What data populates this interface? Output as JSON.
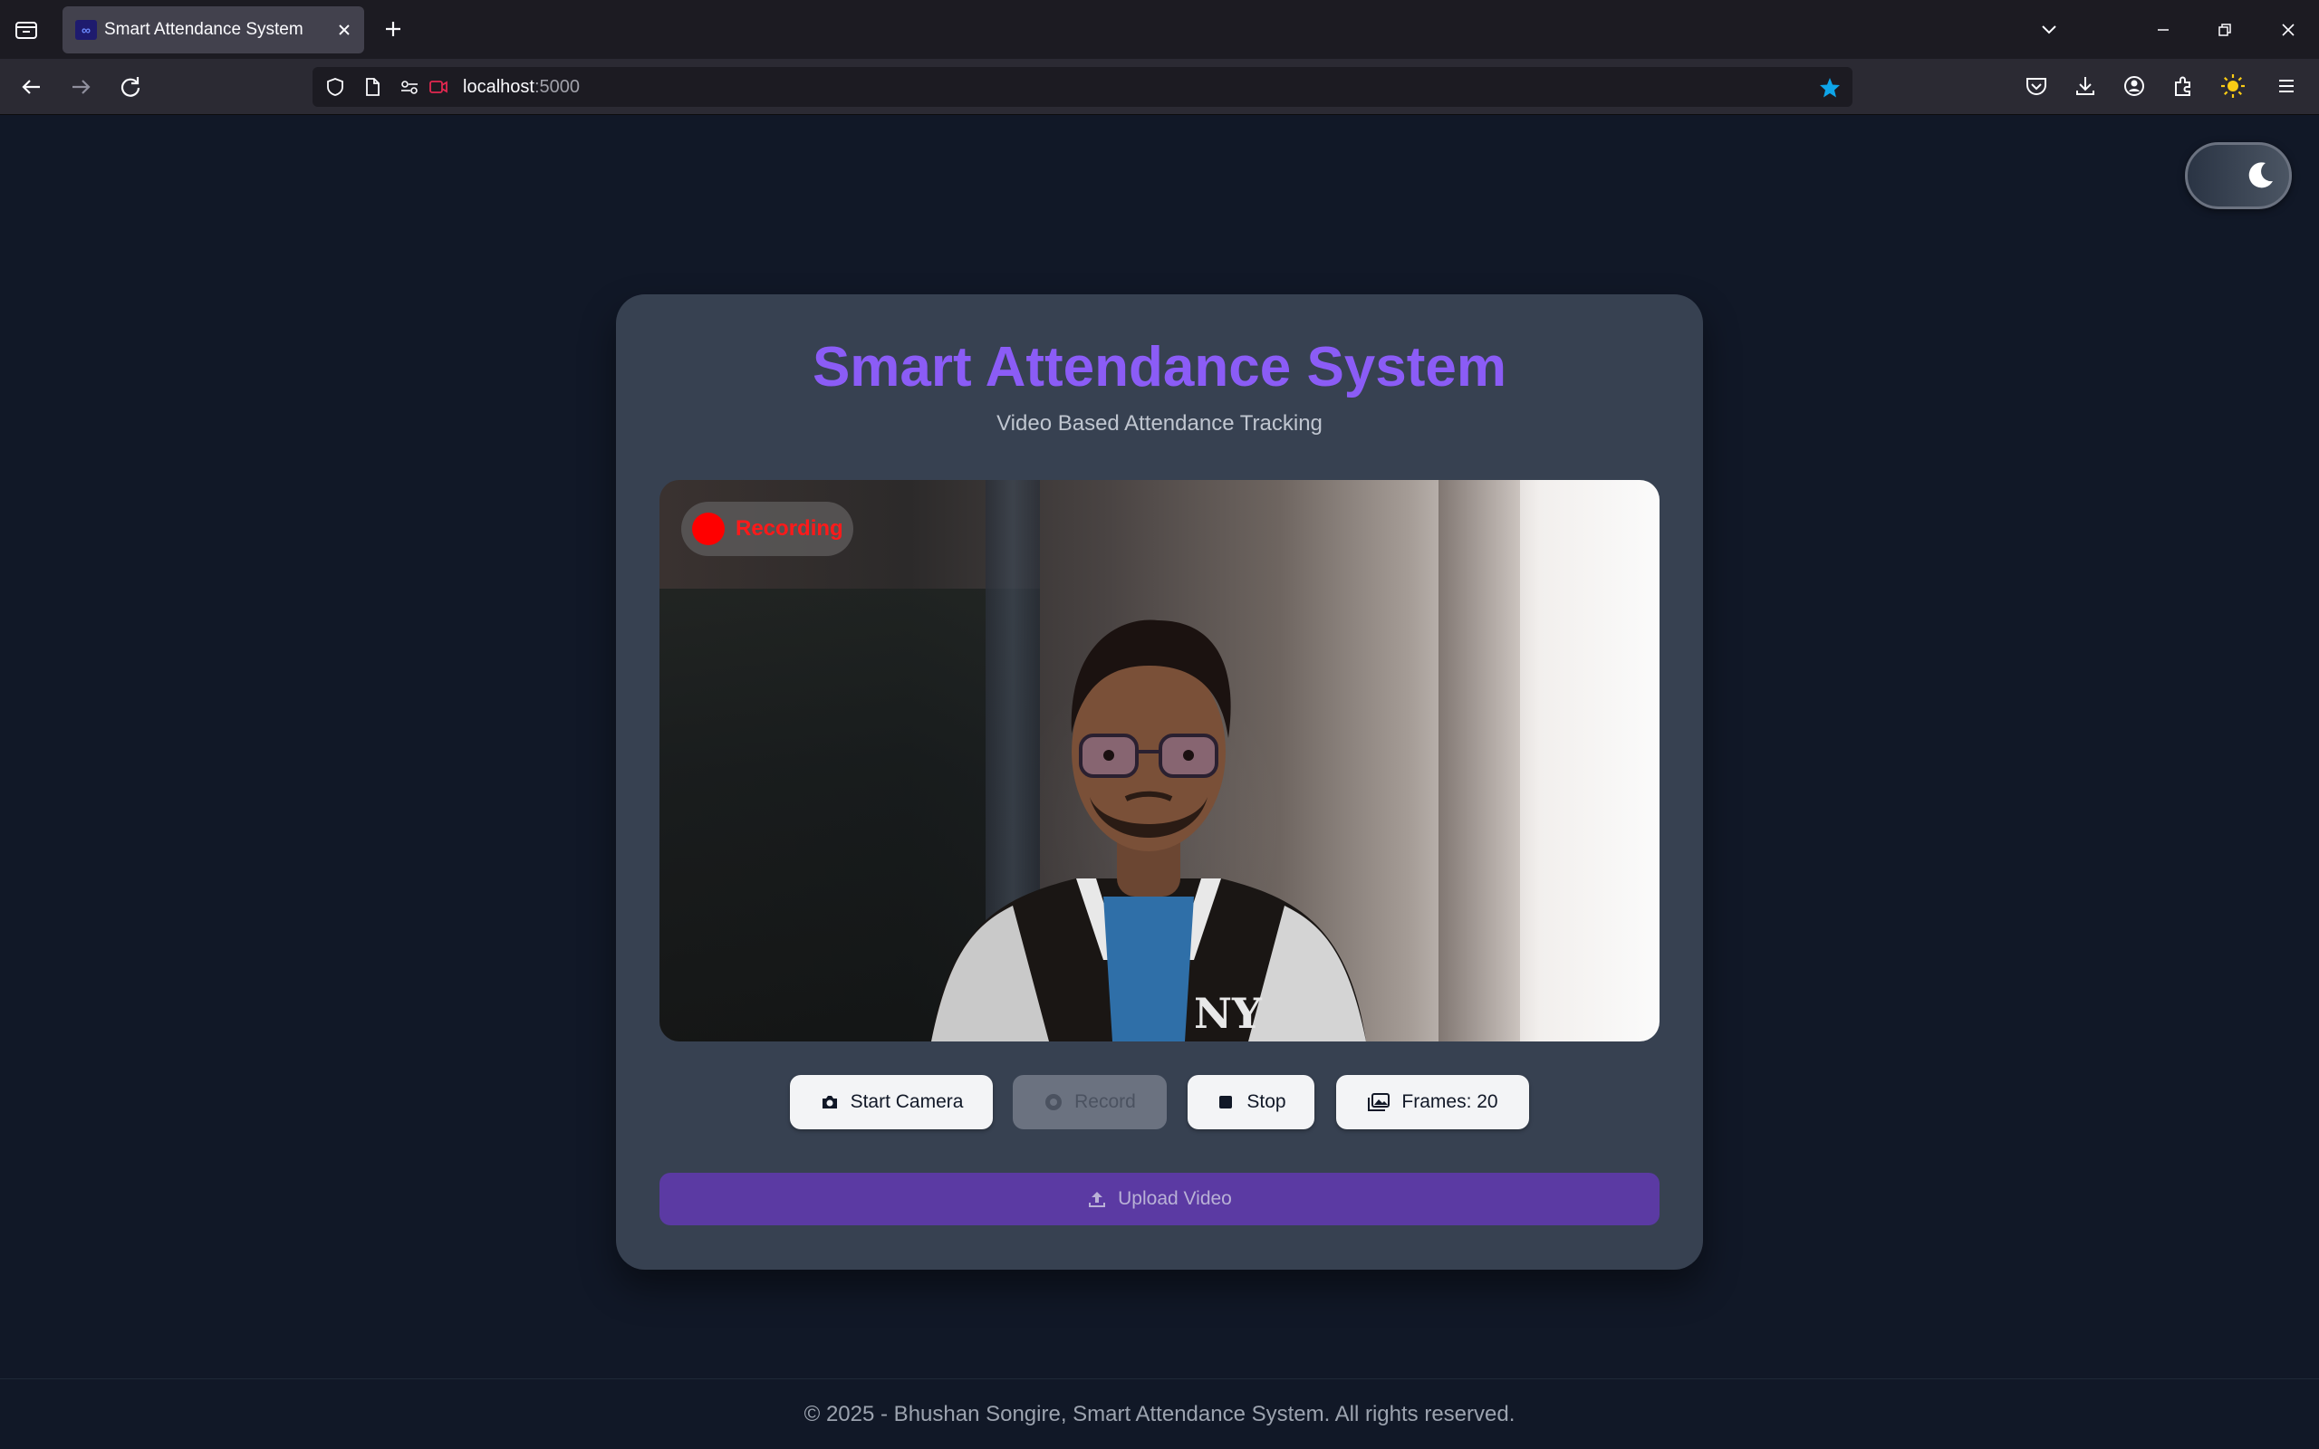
{
  "browser": {
    "tab": {
      "title": "Smart Attendance System",
      "favicon": "infinity-favicon"
    },
    "url": {
      "host": "localhost",
      "port": ":5000"
    },
    "icons": [
      "tab-list-icon",
      "close-icon",
      "plus-icon",
      "chevron-down-icon",
      "minimize-icon",
      "restore-icon",
      "window-close-icon",
      "back-icon",
      "forward-icon",
      "reload-icon",
      "shield-icon",
      "page-icon",
      "permissions-icon",
      "camera-sharing-icon",
      "star-icon",
      "pocket-icon",
      "download-icon",
      "account-icon",
      "extensions-icon",
      "sun-icon",
      "menu-icon"
    ],
    "colors": {
      "star": "#0ea5e9",
      "camera_indicator": "#e22850",
      "sun": "#facc15"
    }
  },
  "page": {
    "theme_toggle": {
      "icon": "moon-icon",
      "mode": "dark"
    },
    "title": "Smart Attendance System",
    "subtitle": "Video Based Attendance Tracking",
    "video": {
      "recording_label": "Recording",
      "content": "webcam-feed"
    },
    "controls": {
      "start_camera": "Start Camera",
      "record": "Record",
      "stop": "Stop",
      "frames": "Frames: 20"
    },
    "upload": "Upload Video",
    "footer": "© 2025 - Bhushan Songire, Smart Attendance System. All rights reserved.",
    "colors": {
      "accent": "#8b5cf6",
      "upload_bg": "#5b3aa3",
      "card_bg": "#374151",
      "page_bg": "#111827",
      "recording": "#ff0000"
    }
  }
}
